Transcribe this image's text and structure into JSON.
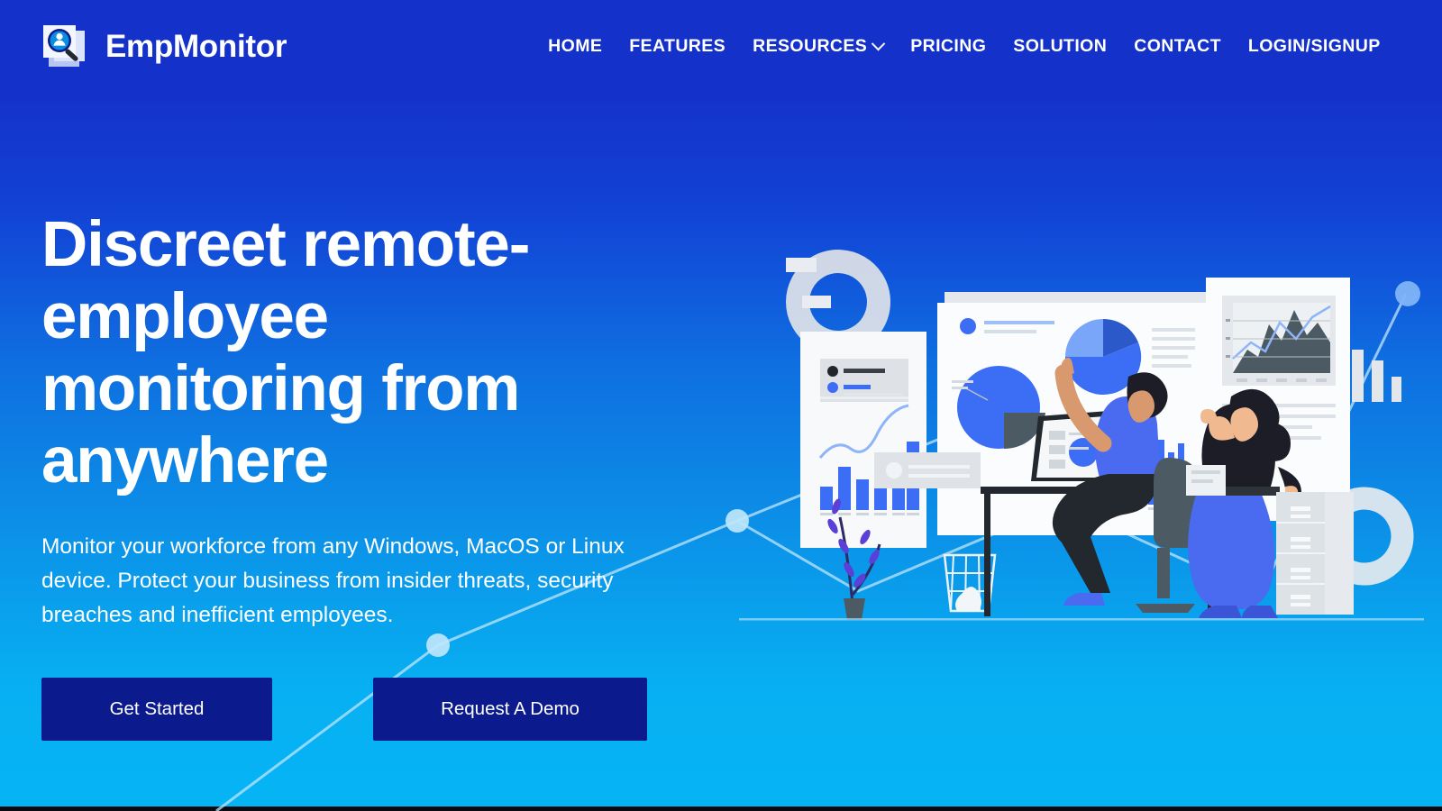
{
  "brand": {
    "name": "EmpMonitor",
    "logo_icon": "magnifier-person-logo-icon",
    "accent_color": "#1431c9"
  },
  "nav": {
    "items": [
      {
        "label": "HOME",
        "name": "nav-item-home",
        "has_dropdown": false
      },
      {
        "label": "FEATURES",
        "name": "nav-item-features",
        "has_dropdown": false
      },
      {
        "label": "RESOURCES",
        "name": "nav-item-resources",
        "has_dropdown": true
      },
      {
        "label": "PRICING",
        "name": "nav-item-pricing",
        "has_dropdown": false
      },
      {
        "label": "SOLUTION",
        "name": "nav-item-solution",
        "has_dropdown": false
      },
      {
        "label": "CONTACT",
        "name": "nav-item-contact",
        "has_dropdown": false
      },
      {
        "label": "LOGIN/SIGNUP",
        "name": "nav-item-login-signup",
        "has_dropdown": false
      }
    ]
  },
  "hero": {
    "headline": "Discreet remote-employee monitoring from anywhere",
    "subtext": "Monitor your workforce from any Windows, MacOS or Linux device. Protect your business from insider threats, security breaches and inefficient employees.",
    "primary_cta": "Get Started",
    "secondary_cta": "Request A Demo",
    "illustration": "team-analytics-dashboard-illustration"
  },
  "colors": {
    "header_blue": "#1431c9",
    "gradient_top": "#1431c9",
    "gradient_bottom": "#06b4f4",
    "button_navy": "#0b1a8c",
    "text_white": "#ffffff",
    "chart_blue": "#3b6ef5",
    "chart_dark": "#4c5a63"
  }
}
